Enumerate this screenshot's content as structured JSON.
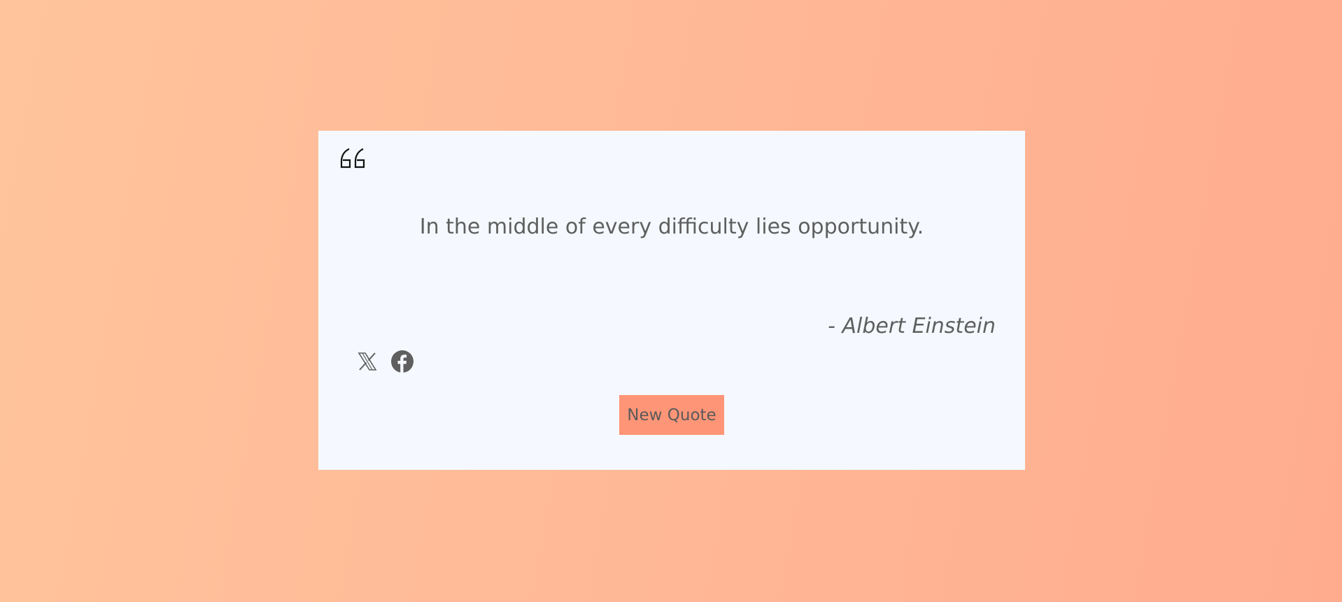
{
  "quote": {
    "text": "In the middle of every difficulty lies opportunity.",
    "author": "- Albert Einstein"
  },
  "icons": {
    "quote_mark": "quote-mark-icon",
    "share_x": "x-twitter-icon",
    "share_facebook": "facebook-icon"
  },
  "actions": {
    "new_quote_label": "New Quote"
  },
  "colors": {
    "background_start": "#ffc49c",
    "background_end": "#ffac8e",
    "card": "#f5f9ff",
    "text": "#5f5f5f",
    "button": "#ff9577"
  }
}
